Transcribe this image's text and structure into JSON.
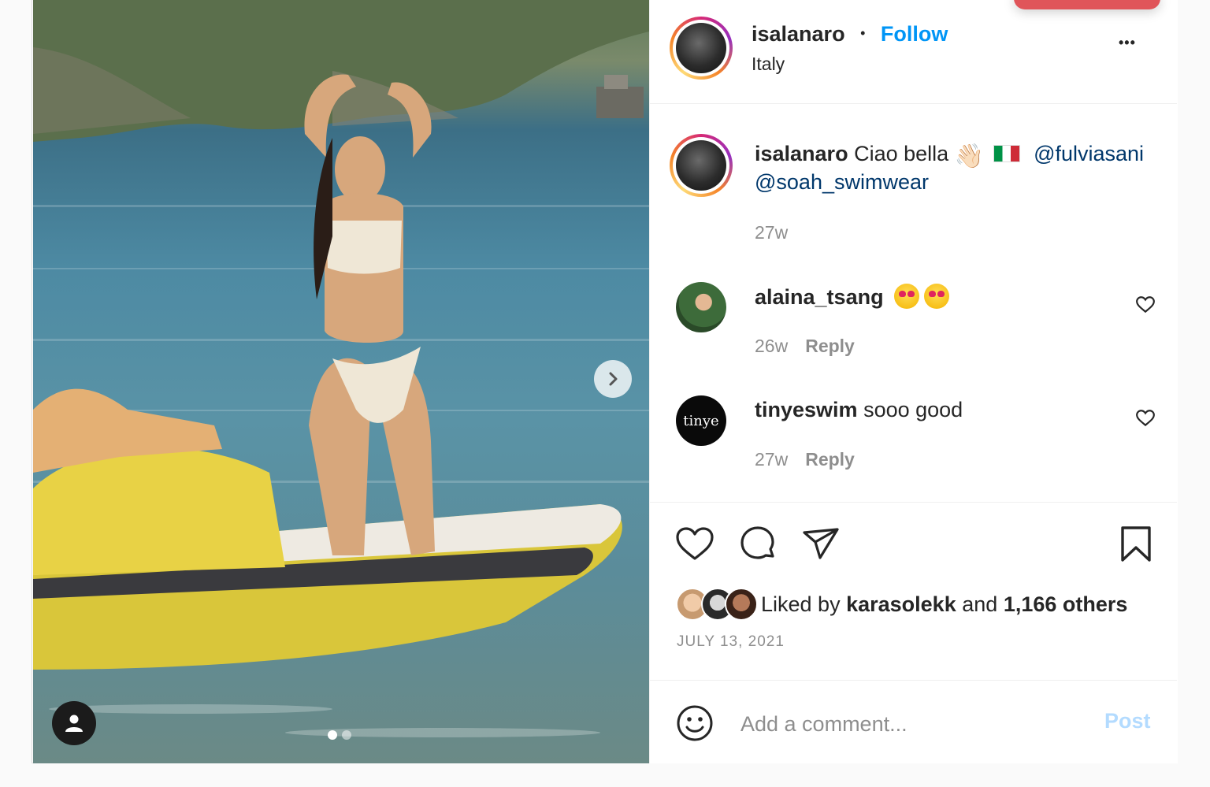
{
  "post": {
    "author": "isalanaro",
    "location": "Italy",
    "follow_label": "Follow",
    "separator": "•",
    "more_label": "•••"
  },
  "caption": {
    "author": "isalanaro",
    "text": "Ciao bella",
    "emoji_wave": "👋🏻",
    "emoji_flag": "🇮🇹",
    "mention_1": "@fulviasani",
    "mention_2": "@soah_swimwear",
    "time": "27w"
  },
  "comments": [
    {
      "author": "alaina_tsang",
      "text": "",
      "emoji": "😍 😍",
      "time": "26w",
      "reply_label": "Reply"
    },
    {
      "author": "tinyeswim",
      "text": "sooo good",
      "time": "27w",
      "reply_label": "Reply",
      "avatar_text": "tinye"
    }
  ],
  "likes": {
    "prefix": "Liked by",
    "first_user": "karasolekk",
    "and": "and",
    "others": "1,166 others"
  },
  "date": "JULY 13, 2021",
  "comment_box": {
    "placeholder": "Add a comment...",
    "post_label": "Post"
  },
  "colors": {
    "follow": "#0095f6",
    "mention": "#00376b",
    "post_disabled": "#b3dbff",
    "muted": "#8e8e8e"
  },
  "icons": [
    "chevron-right-icon",
    "user-icon",
    "more-icon",
    "heart-icon",
    "comment-icon",
    "share-icon",
    "bookmark-icon",
    "emoji-icon"
  ],
  "carousel": {
    "pages": 2,
    "current": 1
  }
}
